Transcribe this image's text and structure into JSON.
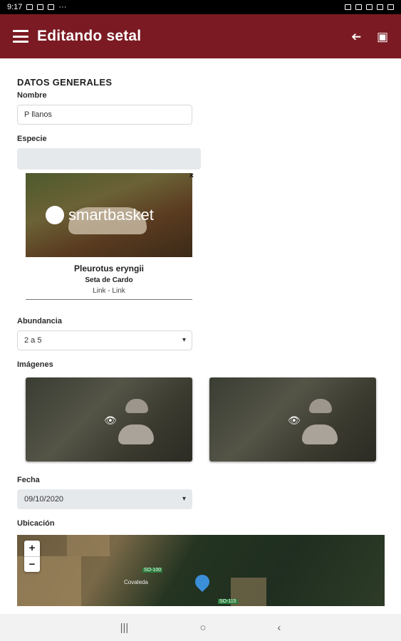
{
  "status_bar": {
    "time": "9:17",
    "dots": "···"
  },
  "app_bar": {
    "title": "Editando setal",
    "back_glyph": "➔",
    "save_glyph": "▣"
  },
  "form": {
    "section_title": "DATOS GENERALES",
    "nombre_label": "Nombre",
    "nombre_value": "P llanos",
    "especie_label": "Especie",
    "especie_value": "",
    "species_card": {
      "logo_text": "smartbasket",
      "scientific_name": "Pleurotus eryngii",
      "common_name": "Seta de Cardo",
      "links": "Link - Link",
      "close_glyph": "×"
    },
    "abundancia_label": "Abundancia",
    "abundancia_value": "2 a 5",
    "imagenes_label": "Imágenes",
    "fecha_label": "Fecha",
    "fecha_value": "09/10/2020",
    "ubicacion_label": "Ubicación"
  },
  "map": {
    "zoom_in": "+",
    "zoom_out": "−",
    "road_label_1": "SO-100",
    "road_label_2": "SO-115",
    "town": "Covaleda"
  },
  "nav_bar": {
    "recent": "|||",
    "home": "○",
    "back": "‹"
  }
}
